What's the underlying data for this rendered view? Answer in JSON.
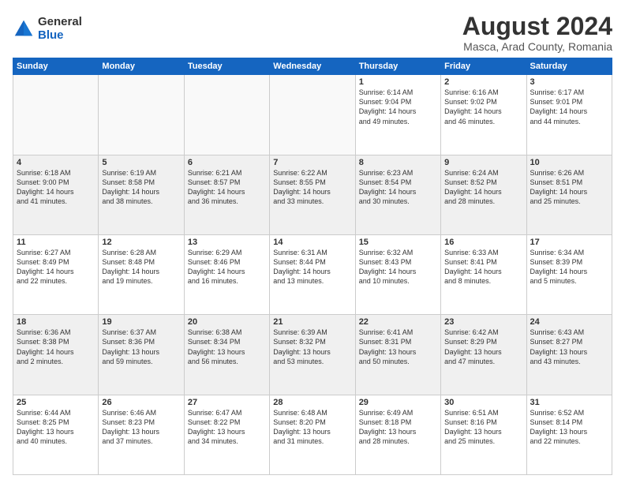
{
  "logo": {
    "general": "General",
    "blue": "Blue"
  },
  "title": "August 2024",
  "subtitle": "Masca, Arad County, Romania",
  "headers": [
    "Sunday",
    "Monday",
    "Tuesday",
    "Wednesday",
    "Thursday",
    "Friday",
    "Saturday"
  ],
  "rows": [
    [
      {
        "day": "",
        "info": ""
      },
      {
        "day": "",
        "info": ""
      },
      {
        "day": "",
        "info": ""
      },
      {
        "day": "",
        "info": ""
      },
      {
        "day": "1",
        "info": "Sunrise: 6:14 AM\nSunset: 9:04 PM\nDaylight: 14 hours\nand 49 minutes."
      },
      {
        "day": "2",
        "info": "Sunrise: 6:16 AM\nSunset: 9:02 PM\nDaylight: 14 hours\nand 46 minutes."
      },
      {
        "day": "3",
        "info": "Sunrise: 6:17 AM\nSunset: 9:01 PM\nDaylight: 14 hours\nand 44 minutes."
      }
    ],
    [
      {
        "day": "4",
        "info": "Sunrise: 6:18 AM\nSunset: 9:00 PM\nDaylight: 14 hours\nand 41 minutes."
      },
      {
        "day": "5",
        "info": "Sunrise: 6:19 AM\nSunset: 8:58 PM\nDaylight: 14 hours\nand 38 minutes."
      },
      {
        "day": "6",
        "info": "Sunrise: 6:21 AM\nSunset: 8:57 PM\nDaylight: 14 hours\nand 36 minutes."
      },
      {
        "day": "7",
        "info": "Sunrise: 6:22 AM\nSunset: 8:55 PM\nDaylight: 14 hours\nand 33 minutes."
      },
      {
        "day": "8",
        "info": "Sunrise: 6:23 AM\nSunset: 8:54 PM\nDaylight: 14 hours\nand 30 minutes."
      },
      {
        "day": "9",
        "info": "Sunrise: 6:24 AM\nSunset: 8:52 PM\nDaylight: 14 hours\nand 28 minutes."
      },
      {
        "day": "10",
        "info": "Sunrise: 6:26 AM\nSunset: 8:51 PM\nDaylight: 14 hours\nand 25 minutes."
      }
    ],
    [
      {
        "day": "11",
        "info": "Sunrise: 6:27 AM\nSunset: 8:49 PM\nDaylight: 14 hours\nand 22 minutes."
      },
      {
        "day": "12",
        "info": "Sunrise: 6:28 AM\nSunset: 8:48 PM\nDaylight: 14 hours\nand 19 minutes."
      },
      {
        "day": "13",
        "info": "Sunrise: 6:29 AM\nSunset: 8:46 PM\nDaylight: 14 hours\nand 16 minutes."
      },
      {
        "day": "14",
        "info": "Sunrise: 6:31 AM\nSunset: 8:44 PM\nDaylight: 14 hours\nand 13 minutes."
      },
      {
        "day": "15",
        "info": "Sunrise: 6:32 AM\nSunset: 8:43 PM\nDaylight: 14 hours\nand 10 minutes."
      },
      {
        "day": "16",
        "info": "Sunrise: 6:33 AM\nSunset: 8:41 PM\nDaylight: 14 hours\nand 8 minutes."
      },
      {
        "day": "17",
        "info": "Sunrise: 6:34 AM\nSunset: 8:39 PM\nDaylight: 14 hours\nand 5 minutes."
      }
    ],
    [
      {
        "day": "18",
        "info": "Sunrise: 6:36 AM\nSunset: 8:38 PM\nDaylight: 14 hours\nand 2 minutes."
      },
      {
        "day": "19",
        "info": "Sunrise: 6:37 AM\nSunset: 8:36 PM\nDaylight: 13 hours\nand 59 minutes."
      },
      {
        "day": "20",
        "info": "Sunrise: 6:38 AM\nSunset: 8:34 PM\nDaylight: 13 hours\nand 56 minutes."
      },
      {
        "day": "21",
        "info": "Sunrise: 6:39 AM\nSunset: 8:32 PM\nDaylight: 13 hours\nand 53 minutes."
      },
      {
        "day": "22",
        "info": "Sunrise: 6:41 AM\nSunset: 8:31 PM\nDaylight: 13 hours\nand 50 minutes."
      },
      {
        "day": "23",
        "info": "Sunrise: 6:42 AM\nSunset: 8:29 PM\nDaylight: 13 hours\nand 47 minutes."
      },
      {
        "day": "24",
        "info": "Sunrise: 6:43 AM\nSunset: 8:27 PM\nDaylight: 13 hours\nand 43 minutes."
      }
    ],
    [
      {
        "day": "25",
        "info": "Sunrise: 6:44 AM\nSunset: 8:25 PM\nDaylight: 13 hours\nand 40 minutes."
      },
      {
        "day": "26",
        "info": "Sunrise: 6:46 AM\nSunset: 8:23 PM\nDaylight: 13 hours\nand 37 minutes."
      },
      {
        "day": "27",
        "info": "Sunrise: 6:47 AM\nSunset: 8:22 PM\nDaylight: 13 hours\nand 34 minutes."
      },
      {
        "day": "28",
        "info": "Sunrise: 6:48 AM\nSunset: 8:20 PM\nDaylight: 13 hours\nand 31 minutes."
      },
      {
        "day": "29",
        "info": "Sunrise: 6:49 AM\nSunset: 8:18 PM\nDaylight: 13 hours\nand 28 minutes."
      },
      {
        "day": "30",
        "info": "Sunrise: 6:51 AM\nSunset: 8:16 PM\nDaylight: 13 hours\nand 25 minutes."
      },
      {
        "day": "31",
        "info": "Sunrise: 6:52 AM\nSunset: 8:14 PM\nDaylight: 13 hours\nand 22 minutes."
      }
    ]
  ]
}
